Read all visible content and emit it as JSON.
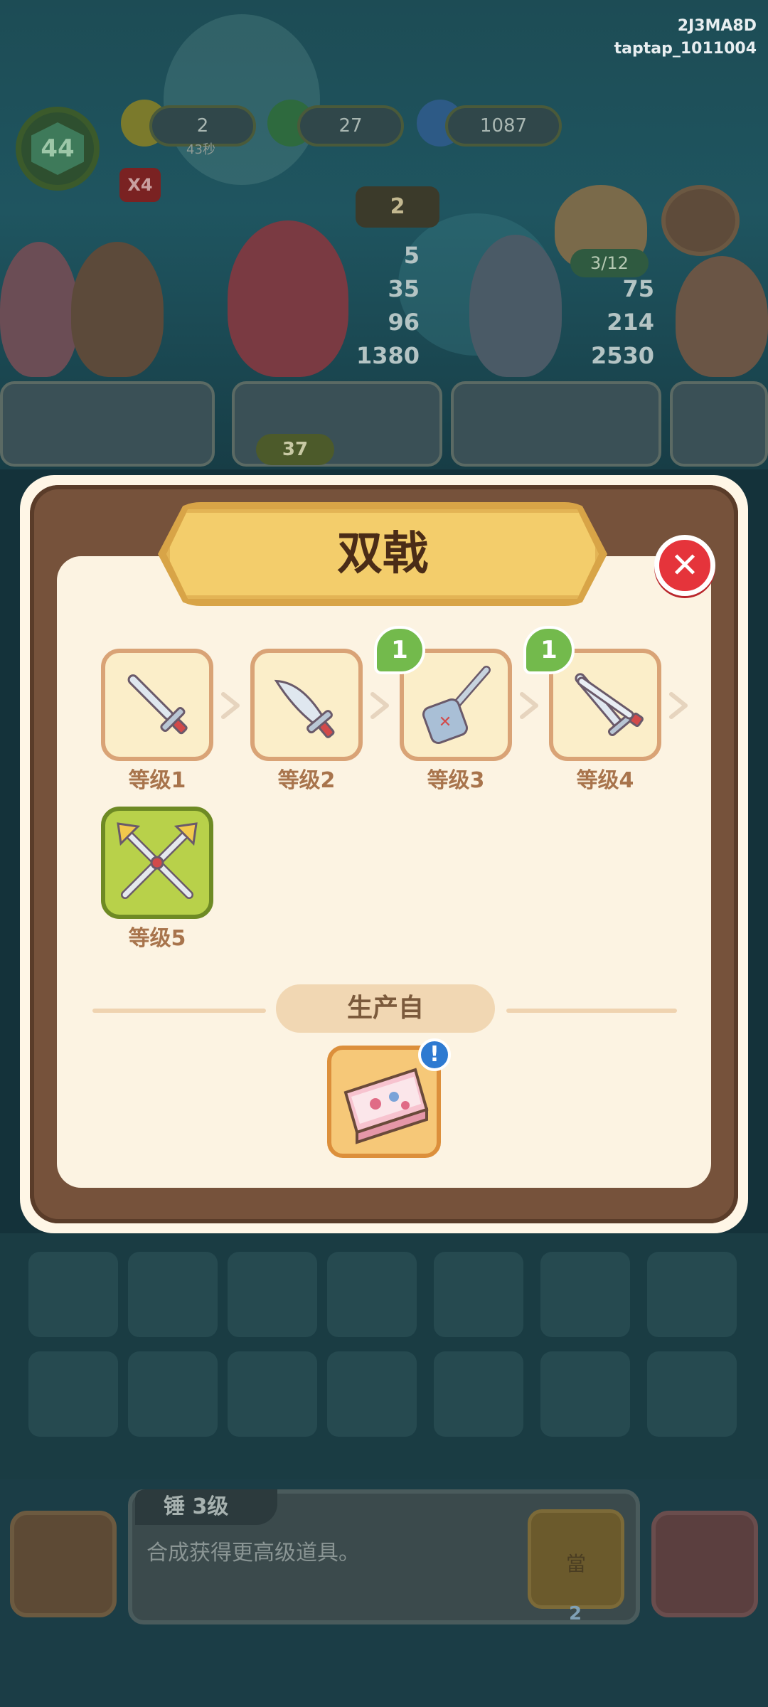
{
  "watermark": {
    "line1": "2J3MA8D",
    "line2": "taptap_1011004"
  },
  "hud": {
    "player_level": "44",
    "multiplier": "X4",
    "energy": "2",
    "energy_timer": "43秒",
    "jade": "27",
    "spirit": "1087",
    "flowers": "2",
    "stats_left": [
      "5",
      "35",
      "96",
      "1380"
    ],
    "stats_right": [
      "75",
      "214",
      "2530"
    ],
    "customers": "3/12",
    "item_price": "37"
  },
  "modal": {
    "title": "双戟",
    "close_icon": "close-icon",
    "levels": [
      {
        "label": "等级1",
        "icon": "sword-icon",
        "count": null
      },
      {
        "label": "等级2",
        "icon": "broadsword-icon",
        "count": null
      },
      {
        "label": "等级3",
        "icon": "mace-icon",
        "count": "1"
      },
      {
        "label": "等级4",
        "icon": "crossed-swords-icon",
        "count": "1"
      },
      {
        "label": "等级5",
        "icon": "twin-halberds-icon",
        "count": null
      }
    ],
    "source_title": "生产自",
    "source_item_icon": "scroll-box-icon",
    "source_badge": "!"
  },
  "bottom": {
    "item_name": "锤 3级",
    "description": "合成获得更高级道具。",
    "bag_label": "當",
    "bag_count": "2"
  },
  "colors": {
    "accent_gold": "#f3cd6b",
    "frame_brown": "#76523b",
    "close_red": "#e5343b",
    "badge_green": "#73ba4c",
    "max_level_green": "#b8d14a"
  }
}
